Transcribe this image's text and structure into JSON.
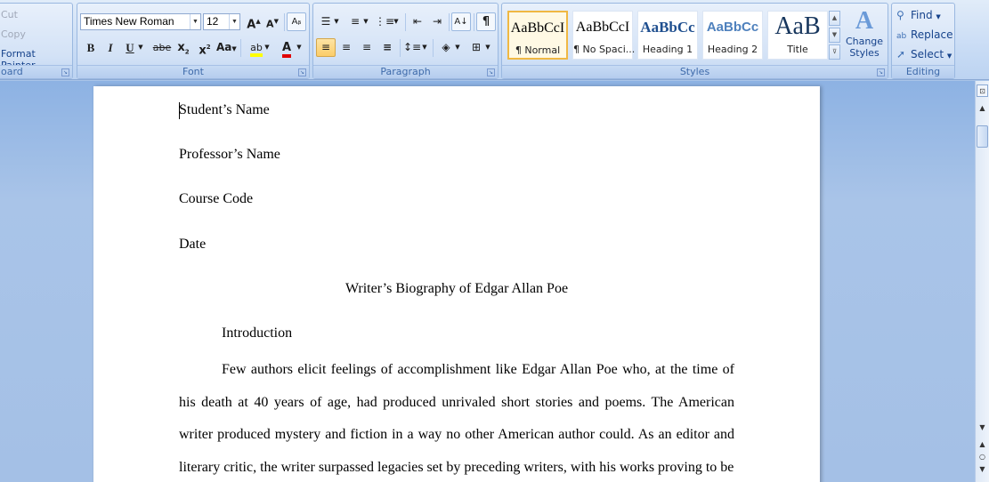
{
  "ribbon": {
    "clipboard": {
      "cut": "Cut",
      "copy": "Copy",
      "format_painter": "Format Painter",
      "label": "oard"
    },
    "font": {
      "font_name": "Times New Roman",
      "font_size": "12",
      "label": "Font"
    },
    "paragraph": {
      "label": "Paragraph"
    },
    "styles": {
      "label": "Styles",
      "gallery": [
        {
          "sample": "AaBbCcI",
          "name": "¶ Normal"
        },
        {
          "sample": "AaBbCcI",
          "name": "¶ No Spaci..."
        },
        {
          "sample": "AaBbCc",
          "name": "Heading 1"
        },
        {
          "sample": "AaBbCc",
          "name": "Heading 2"
        },
        {
          "sample": "AaB",
          "name": "Title"
        }
      ],
      "change_styles": "Change Styles"
    },
    "editing": {
      "label": "Editing",
      "find": "Find",
      "replace": "Replace",
      "select": "Select"
    }
  },
  "document": {
    "student_name": "Student’s Name",
    "professor_name": "Professor’s Name",
    "course_code": "Course Code",
    "date": "Date",
    "title": "Writer’s Biography of Edgar Allan Poe",
    "heading": "Introduction",
    "body": "Few authors elicit feelings of accomplishment like Edgar Allan Poe who, at the time of his death at 40 years of age, had produced unrivaled short stories and poems. The American writer produced mystery and fiction in a way no other American author could. As an editor and literary critic, the writer surpassed legacies set by preceding writers, with his works proving to be"
  },
  "colors": {
    "ribbon_text": "#15428b",
    "selected_style_border": "#f0b843",
    "workspace": "#a9c4e8"
  }
}
